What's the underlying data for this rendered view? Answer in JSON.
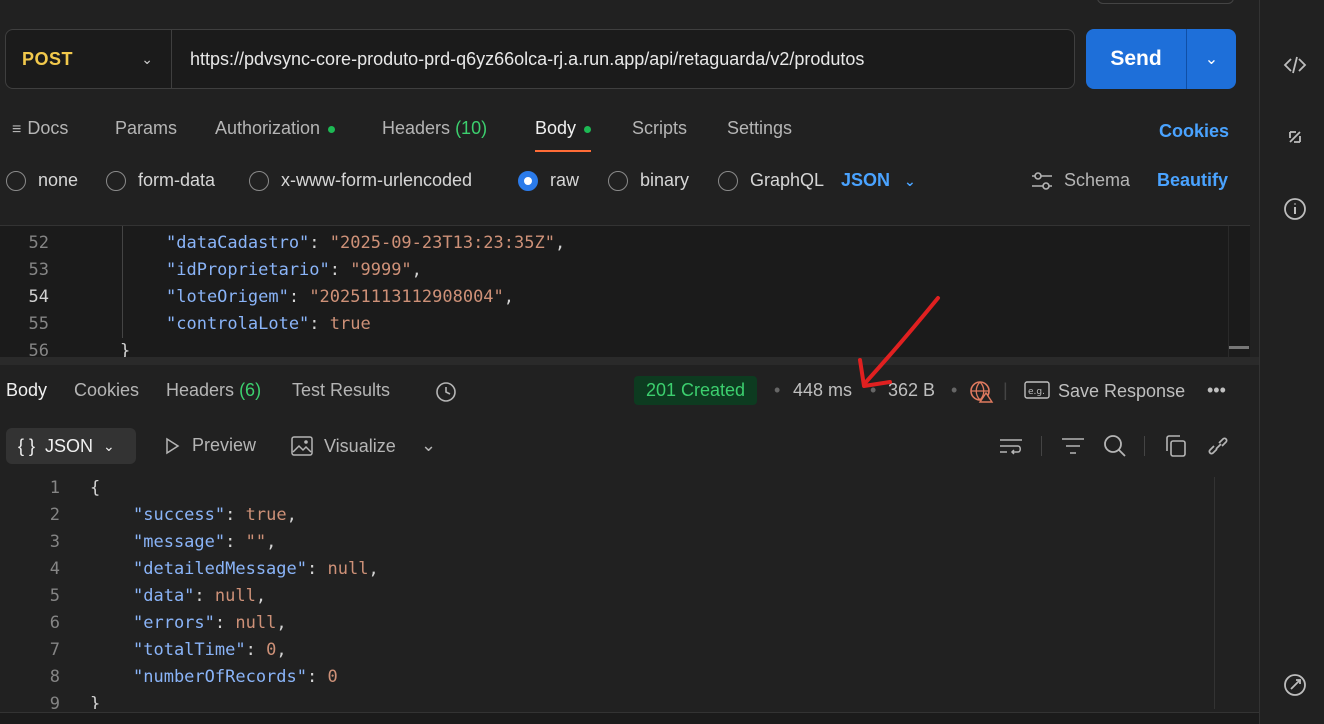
{
  "request": {
    "method": "POST",
    "url": "https://pdvsync-core-produto-prd-q6yz66olca-rj.a.run.app/api/retaguarda/v2/produtos",
    "send_label": "Send"
  },
  "request_tabs": {
    "docs": "Docs",
    "params": "Params",
    "authorization": "Authorization",
    "headers": "Headers",
    "headers_count": "(10)",
    "body": "Body",
    "scripts": "Scripts",
    "settings": "Settings",
    "cookies": "Cookies"
  },
  "body_types": {
    "none": "none",
    "form_data": "form-data",
    "urlencoded": "x-www-form-urlencoded",
    "raw": "raw",
    "binary": "binary",
    "graphql": "GraphQL",
    "selected": "raw",
    "language": "JSON",
    "schema": "Schema",
    "beautify": "Beautify"
  },
  "request_editor": {
    "lines": [
      {
        "n": "52",
        "key": "\"dataCadastro\"",
        "value": "\"2025-09-23T13:23:35Z\"",
        "tail": ","
      },
      {
        "n": "53",
        "key": "\"idProprietario\"",
        "value": "\"9999\"",
        "tail": ","
      },
      {
        "n": "54",
        "key": "\"loteOrigem\"",
        "value": "\"20251113112908004\"",
        "tail": ","
      },
      {
        "n": "55",
        "key": "\"controlaLote\"",
        "value": "true",
        "tail": ""
      },
      {
        "n": "56",
        "brace": "}"
      }
    ]
  },
  "response": {
    "tabs": {
      "body": "Body",
      "cookies": "Cookies",
      "headers": "Headers",
      "headers_count": "(6)",
      "test_results": "Test Results"
    },
    "status": "201 Created",
    "time": "448 ms",
    "size": "362 B",
    "save_response": "Save Response",
    "more": "•••",
    "format": "JSON",
    "preview": "Preview",
    "visualize": "Visualize",
    "lines": [
      {
        "n": "1",
        "brace": "{"
      },
      {
        "n": "2",
        "key": "\"success\"",
        "value": "true",
        "tail": ","
      },
      {
        "n": "3",
        "key": "\"message\"",
        "value": "\"\"",
        "tail": ","
      },
      {
        "n": "4",
        "key": "\"detailedMessage\"",
        "value": "null",
        "tail": ","
      },
      {
        "n": "5",
        "key": "\"data\"",
        "value": "null",
        "tail": ","
      },
      {
        "n": "6",
        "key": "\"errors\"",
        "value": "null",
        "tail": ","
      },
      {
        "n": "7",
        "key": "\"totalTime\"",
        "value": "0",
        "tail": ","
      },
      {
        "n": "8",
        "key": "\"numberOfRecords\"",
        "value": "0",
        "tail": ""
      },
      {
        "n": "9",
        "brace": "}"
      }
    ]
  },
  "colors": {
    "accent": "#1e6fd9",
    "status_green": "#3ccf6e",
    "method_yellow": "#f2c94c",
    "tab_underline": "#ff6c37",
    "annotation_red": "#e02020"
  }
}
